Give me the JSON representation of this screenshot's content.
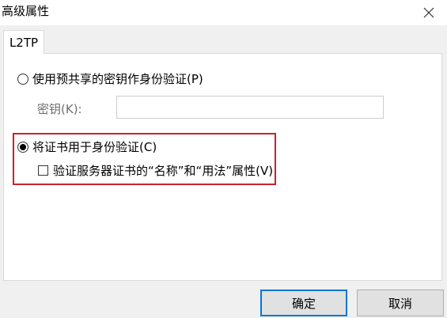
{
  "window": {
    "title": "高级属性",
    "close_icon": "close-icon"
  },
  "tabs": [
    {
      "label": "L2TP",
      "selected": true
    }
  ],
  "auth": {
    "psk_option_label": "使用预共享的密钥作身份验证(P)",
    "psk_selected": false,
    "key_label": "密钥(K):",
    "key_value": "",
    "cert_option_label": "将证书用于身份验证(C)",
    "cert_selected": true,
    "verify_checkbox_label": "验证服务器证书的“名称”和“用法”属性(V)",
    "verify_checked": false
  },
  "highlight_color": "#c8232c",
  "footer": {
    "ok_label": "确定",
    "cancel_label": "取消"
  }
}
